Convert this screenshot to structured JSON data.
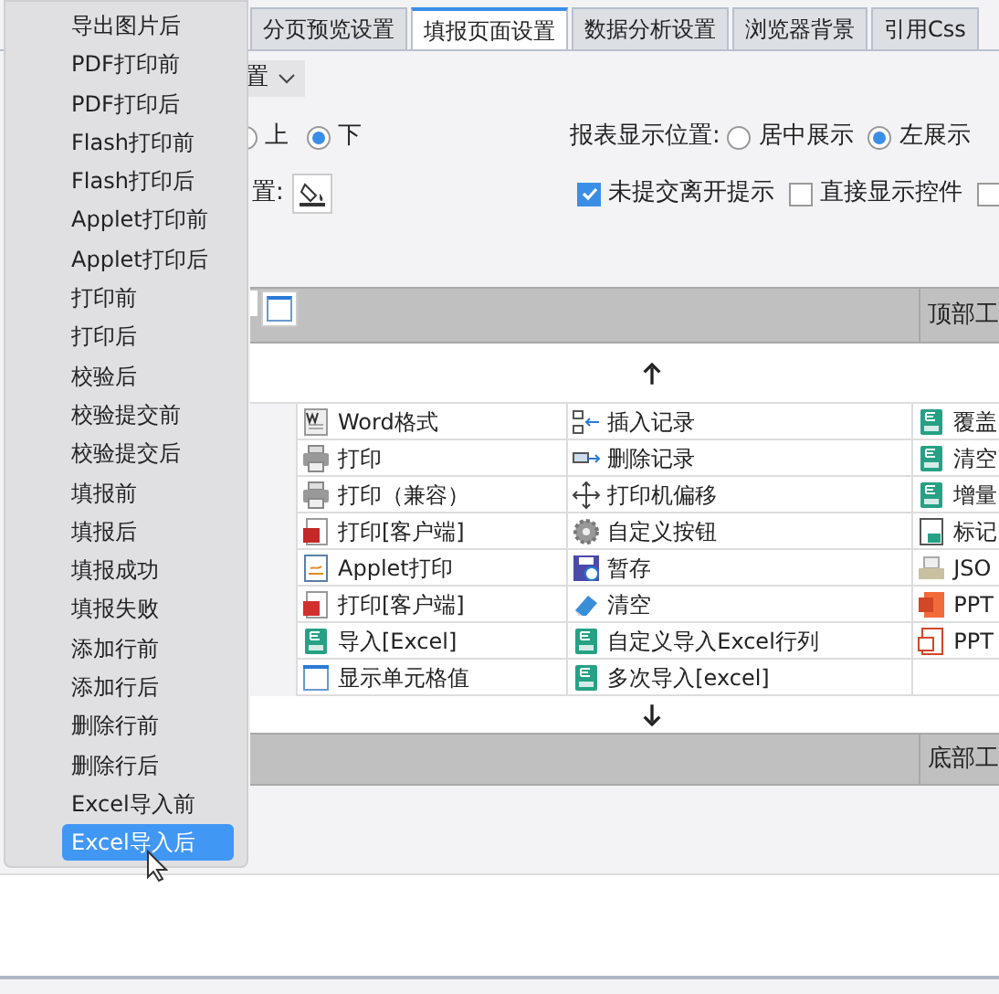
{
  "tabs": [
    {
      "label": "分页预览设置",
      "selected": false
    },
    {
      "label": "填报页面设置",
      "selected": true
    },
    {
      "label": "数据分析设置",
      "selected": false
    },
    {
      "label": "浏览器背景",
      "selected": false
    },
    {
      "label": "引用Css",
      "selected": false
    }
  ],
  "settings_select": {
    "value": "置"
  },
  "toolbar_position": {
    "options": [
      {
        "label": "上",
        "selected": false
      },
      {
        "label": "下",
        "selected": true
      }
    ]
  },
  "report_position": {
    "label": "报表显示位置:",
    "options": [
      {
        "label": "居中展示",
        "selected": false
      },
      {
        "label": "左展示",
        "selected": true
      }
    ]
  },
  "background": {
    "label": "置:"
  },
  "checkboxes": [
    {
      "label": "未提交离开提示",
      "checked": true
    },
    {
      "label": "直接显示控件",
      "checked": false
    },
    {
      "checked": false
    }
  ],
  "top_bar": {
    "label": "顶部工"
  },
  "button_grid": [
    [
      "Word格式",
      "插入记录",
      "覆盖"
    ],
    [
      "打印",
      "删除记录",
      "清空"
    ],
    [
      "打印（兼容）",
      "打印机偏移",
      "增量"
    ],
    [
      "打印[客户端]",
      "自定义按钮",
      "标记"
    ],
    [
      "Applet打印",
      "暂存",
      "JSO"
    ],
    [
      "打印[客户端]",
      "清空",
      "PPT"
    ],
    [
      "导入[Excel]",
      "自定义导入Excel行列",
      "PPT"
    ],
    [
      "显示单元格值",
      "多次导入[excel]"
    ]
  ],
  "bottom_bar": {
    "label": "底部工"
  },
  "menu": {
    "items": [
      {
        "label": "导出图片后",
        "selected": false
      },
      {
        "label": "PDF打印前",
        "selected": false
      },
      {
        "label": "PDF打印后",
        "selected": false
      },
      {
        "label": "Flash打印前",
        "selected": false
      },
      {
        "label": "Flash打印后",
        "selected": false
      },
      {
        "label": "Applet打印前",
        "selected": false
      },
      {
        "label": "Applet打印后",
        "selected": false
      },
      {
        "label": "打印前",
        "selected": false
      },
      {
        "label": "打印后",
        "selected": false
      },
      {
        "label": "校验后",
        "selected": false
      },
      {
        "label": "校验提交前",
        "selected": false
      },
      {
        "label": "校验提交后",
        "selected": false
      },
      {
        "label": "填报前",
        "selected": false
      },
      {
        "label": "填报后",
        "selected": false
      },
      {
        "label": "填报成功",
        "selected": false
      },
      {
        "label": "填报失败",
        "selected": false
      },
      {
        "label": "添加行前",
        "selected": false
      },
      {
        "label": "添加行后",
        "selected": false
      },
      {
        "label": "删除行前",
        "selected": false
      },
      {
        "label": "删除行后",
        "selected": false
      },
      {
        "label": "Excel导入前",
        "selected": false
      },
      {
        "label": "Excel导入后",
        "selected": true
      }
    ]
  }
}
